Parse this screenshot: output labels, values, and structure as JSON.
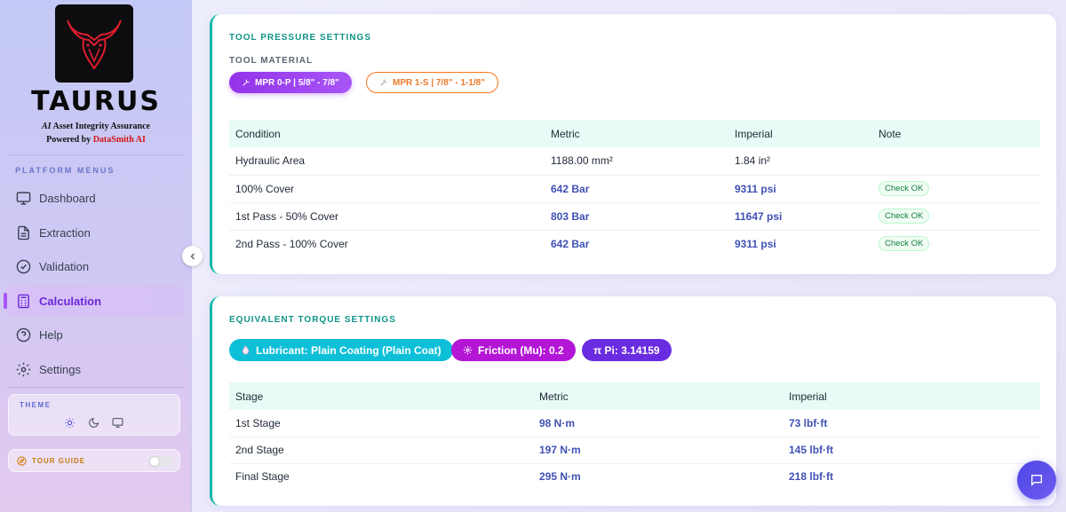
{
  "sidebar": {
    "brand": "TAURUS",
    "tagline_ai": "AI",
    "tagline_rest": " Asset Integrity Assurance",
    "powered_by": "Powered by ",
    "powered_company": "DataSmith AI",
    "section_label": "PLATFORM MENUS",
    "items": [
      {
        "label": "Dashboard",
        "icon": "monitor-icon"
      },
      {
        "label": "Extraction",
        "icon": "document-icon"
      },
      {
        "label": "Validation",
        "icon": "check-circle-icon"
      },
      {
        "label": "Calculation",
        "icon": "calculator-icon",
        "active": true
      },
      {
        "label": "Help",
        "icon": "help-circle-icon"
      },
      {
        "label": "Settings",
        "icon": "gear-icon"
      }
    ],
    "theme_label": "THEME",
    "tour_label": "TOUR GUIDE"
  },
  "pressure": {
    "title": "TOOL PRESSURE SETTINGS",
    "material_label": "TOOL MATERIAL",
    "materials": [
      {
        "label": "MPR 0-P | 5/8\" - 7/8\"",
        "active": true
      },
      {
        "label": "MPR 1-S | 7/8\" - 1-1/8\"",
        "active": false
      }
    ],
    "columns": [
      "Condition",
      "Metric",
      "Imperial",
      "Note"
    ],
    "rows": [
      {
        "condition": "Hydraulic Area",
        "metric": "1188.00 mm²",
        "imperial": "1.84 in²",
        "note": ""
      },
      {
        "condition": "100% Cover",
        "metric": "642 Bar",
        "imperial": "9311 psi",
        "note": "Check OK"
      },
      {
        "condition": "1st Pass - 50% Cover",
        "metric": "803 Bar",
        "imperial": "11647 psi",
        "note": "Check OK"
      },
      {
        "condition": "2nd Pass - 100% Cover",
        "metric": "642 Bar",
        "imperial": "9311 psi",
        "note": "Check OK"
      }
    ]
  },
  "torque": {
    "title": "EQUIVALENT TORQUE SETTINGS",
    "chips": {
      "lubricant": "Lubricant: Plain Coating (Plain Coat)",
      "friction": "Friction (Mu): 0.2",
      "pi": "π Pi: 3.14159"
    },
    "columns": [
      "Stage",
      "Metric",
      "Imperial"
    ],
    "rows": [
      {
        "stage": "1st Stage",
        "metric": "98 N·m",
        "imperial": "73 lbf·ft"
      },
      {
        "stage": "2nd Stage",
        "metric": "197 N·m",
        "imperial": "145 lbf·ft"
      },
      {
        "stage": "Final Stage",
        "metric": "295 N·m",
        "imperial": "218 lbf·ft"
      }
    ]
  },
  "colors": {
    "accent_teal": "#14b8a6",
    "accent_purple": "#9333ea",
    "value_blue": "#3f51b5",
    "lubricant_chip": "#06b6d4",
    "friction_chip": "#a21caf",
    "pi_chip": "#6d28d9"
  }
}
